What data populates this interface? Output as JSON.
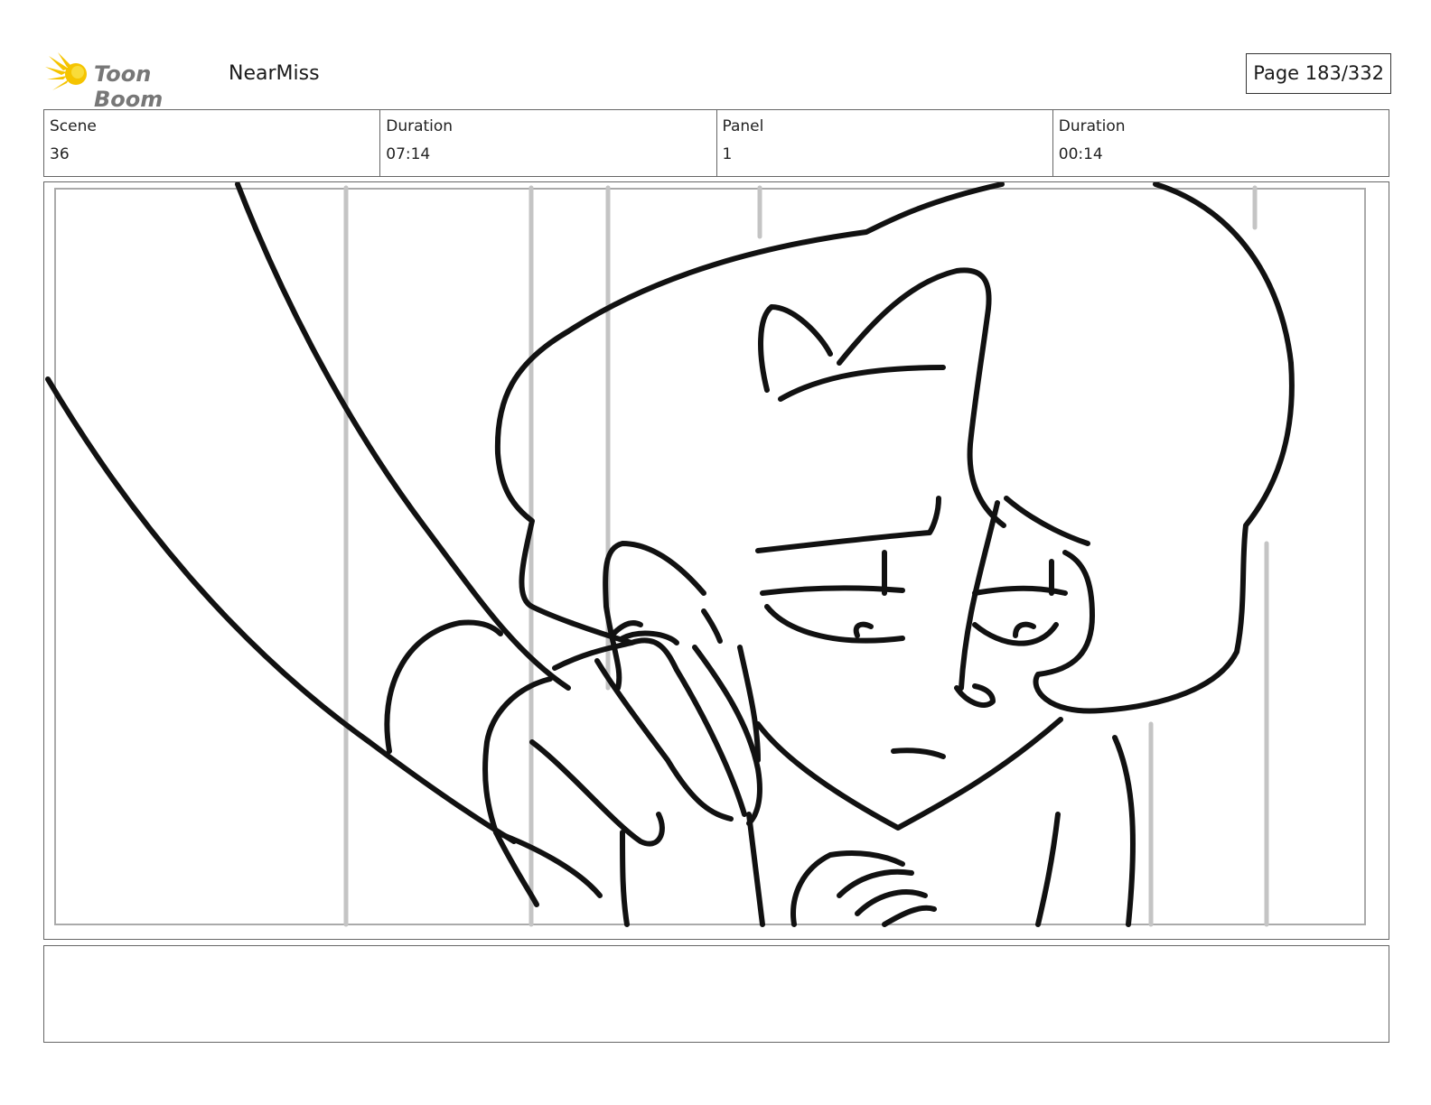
{
  "header": {
    "logo_text": "Toon Boom",
    "project_name": "NearMiss",
    "page_label": "Page 183/332",
    "logo_icon": "starburst-icon",
    "logo_color": "#f5c400"
  },
  "info": {
    "scene_label": "Scene",
    "scene_value": "36",
    "scene_duration_label": "Duration",
    "scene_duration_value": "07:14",
    "panel_label": "Panel",
    "panel_value": "1",
    "panel_duration_label": "Duration",
    "panel_duration_value": "00:14"
  },
  "notes": {
    "text": ""
  }
}
